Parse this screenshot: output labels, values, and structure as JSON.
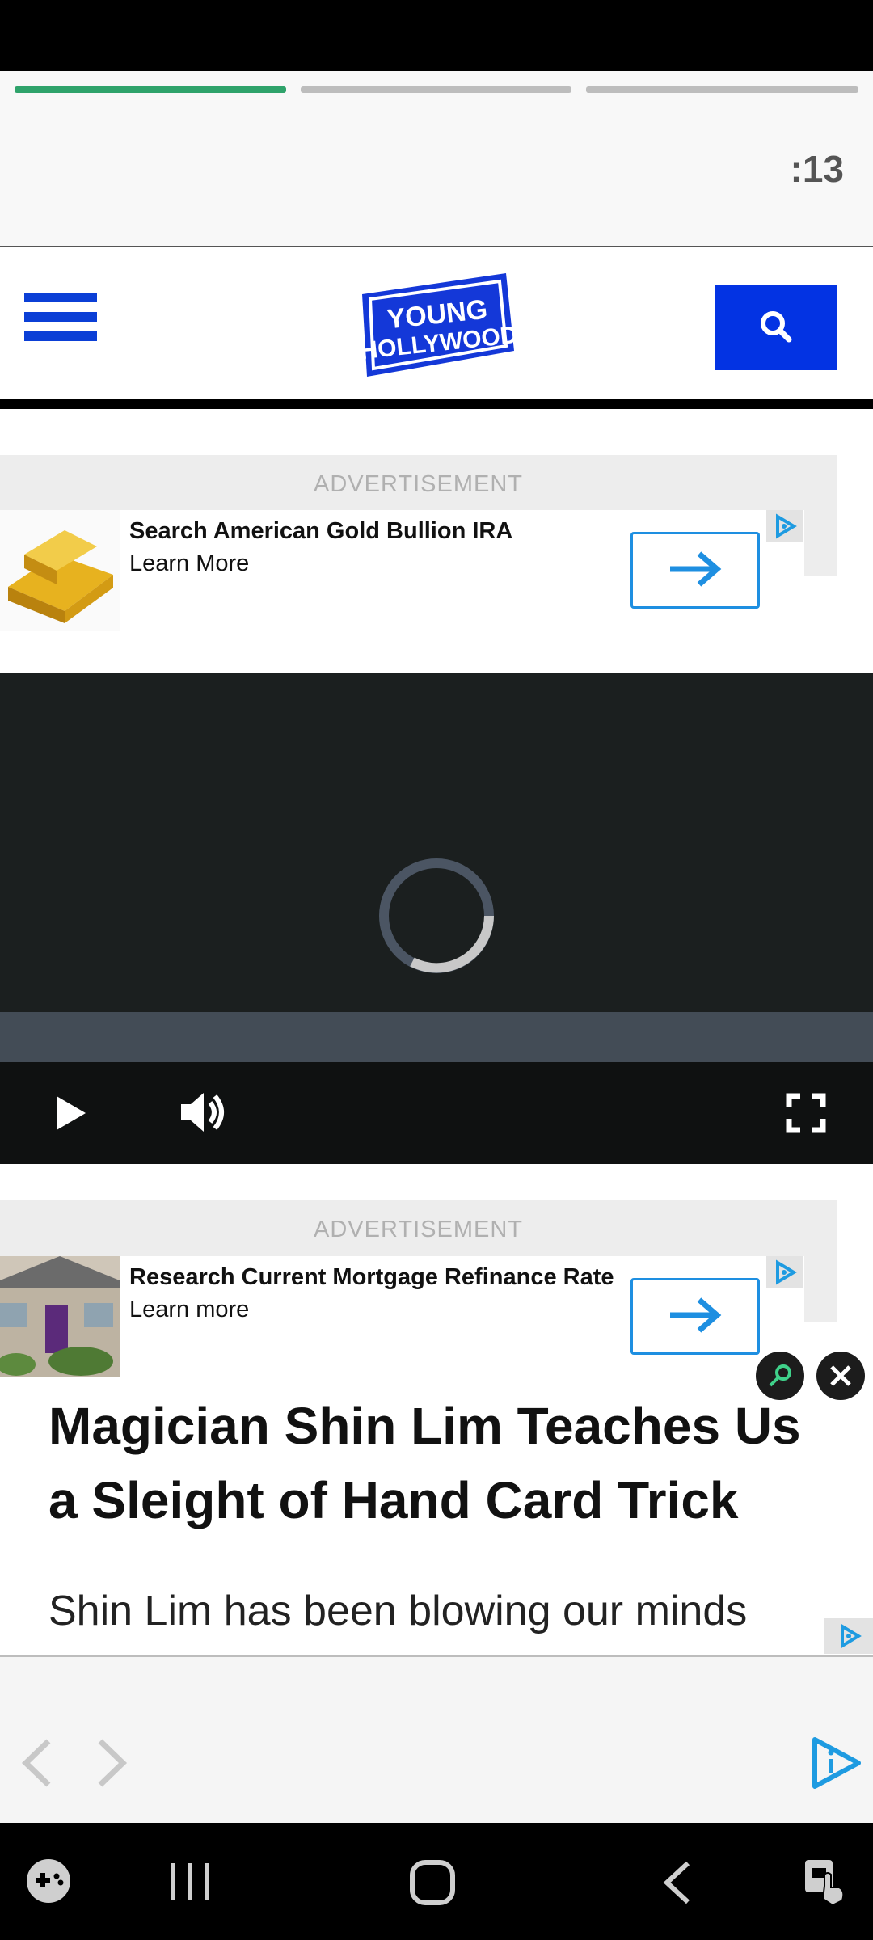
{
  "story": {
    "timer": ":13",
    "progress": [
      1,
      0,
      0
    ]
  },
  "site": {
    "logo_line1": "YOUNG",
    "logo_line2": "HOLLYWOOD",
    "brand_color": "#0333e3"
  },
  "ads": [
    {
      "label": "ADVERTISEMENT",
      "title": "Search American Gold Bullion IRA",
      "cta": "Learn More",
      "thumb": "gold-bars-image"
    },
    {
      "label": "ADVERTISEMENT",
      "title": "Research Current Mortgage Refinance Rate",
      "cta": "Learn more",
      "thumb": "house-image"
    }
  ],
  "video": {
    "state": "loading",
    "controls": [
      "play-icon",
      "volume-icon",
      "fullscreen-icon"
    ]
  },
  "article": {
    "title": "Magician Shin Lim Teaches Us a Sleight of Hand Card Trick",
    "body": "Shin Lim has been blowing our minds"
  },
  "system_nav": [
    "game-launcher-icon",
    "recents-icon",
    "home-icon",
    "back-icon",
    "accessibility-icon"
  ]
}
